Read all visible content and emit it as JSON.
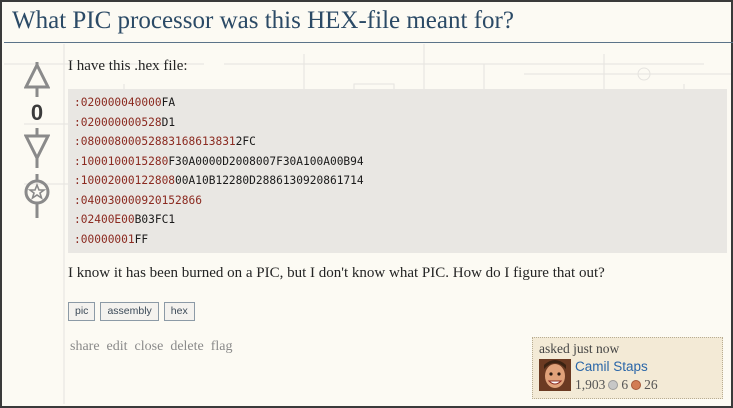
{
  "question": {
    "title": "What PIC processor was this HEX-file meant for?",
    "intro": "I have this .hex file:",
    "vote_count": "0",
    "hex_lines": [
      {
        "colon": ":",
        "colored": "020000040000",
        "rest": "FA"
      },
      {
        "colon": ":",
        "colored": "020000000528",
        "rest": "D1"
      },
      {
        "colon": ":",
        "colored": "08000800052883168613831",
        "rest": "2FC"
      },
      {
        "colon": ":",
        "colored": "1000100015280",
        "rest": "F30A0000D2008007F30A100A00B94"
      },
      {
        "colon": ":",
        "colored": "10002000122808",
        "rest": "00A10B12280D2886130920861714"
      },
      {
        "colon": ":",
        "colored": "040030000920152866",
        "rest": ""
      },
      {
        "colon": ":",
        "colored": "02400E00",
        "rest": "B03FC1"
      },
      {
        "colon": ":",
        "colored": "00000001",
        "rest": "FF"
      }
    ],
    "body": "I know it has been burned on a PIC, but I don't know what PIC. How do I figure that out?",
    "tags": [
      "pic",
      "assembly",
      "hex"
    ],
    "actions": [
      "share",
      "edit",
      "close",
      "delete",
      "flag"
    ]
  },
  "owner": {
    "asked": "asked just now",
    "name": "Camil Staps",
    "reputation": "1,903",
    "silver": "6",
    "bronze": "26"
  },
  "colors": {
    "title": "#2b4a66",
    "code_highlight": "#8b2a20",
    "link": "#2a66a8"
  }
}
